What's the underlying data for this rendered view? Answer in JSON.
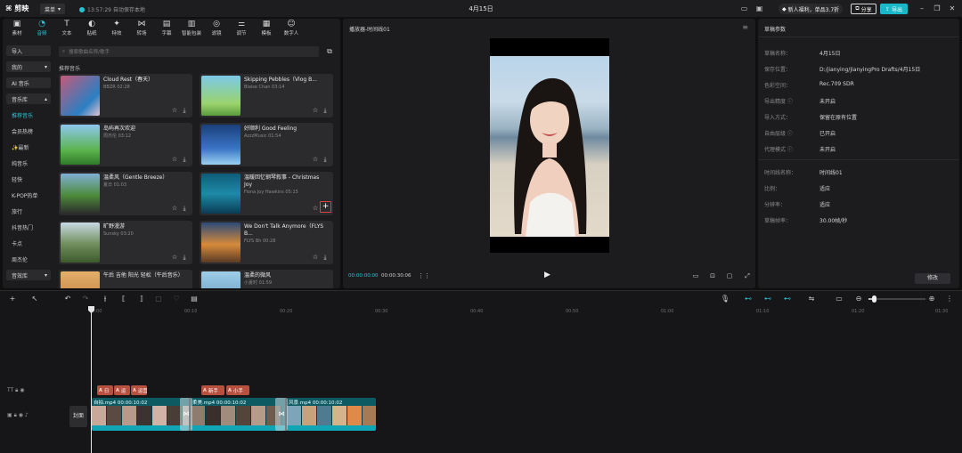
{
  "titlebar": {
    "app_name": "剪映",
    "menu_label": "菜单",
    "autosave": "13:57:29 自动保存本地",
    "doc_title": "4月15日",
    "newbie": "新人福利，单品3.7折",
    "share": "分享",
    "export": "导出"
  },
  "tools": [
    {
      "label": "素材",
      "icon": "media-icon"
    },
    {
      "label": "音频",
      "icon": "audio-icon"
    },
    {
      "label": "文本",
      "icon": "text-icon"
    },
    {
      "label": "贴纸",
      "icon": "sticker-icon"
    },
    {
      "label": "特效",
      "icon": "effects-icon"
    },
    {
      "label": "转场",
      "icon": "transition-icon"
    },
    {
      "label": "字幕",
      "icon": "subtitle-icon"
    },
    {
      "label": "智能包装",
      "icon": "smart-pack-icon"
    },
    {
      "label": "滤镜",
      "icon": "filter-icon"
    },
    {
      "label": "调节",
      "icon": "adjust-icon"
    },
    {
      "label": "模板",
      "icon": "template-icon"
    },
    {
      "label": "数字人",
      "icon": "digital-human-icon"
    }
  ],
  "categories": {
    "import": "导入",
    "mine": "我的",
    "ai_music": "AI 音乐",
    "music_lib": "音乐库",
    "subs": [
      "推荐音乐",
      "会员热榜",
      "✨最新",
      "纯音乐",
      "轻快",
      "K-POP热单",
      "旅行",
      "抖音热门",
      "卡点",
      "周杰伦"
    ],
    "sfx_lib": "音效库"
  },
  "search": {
    "placeholder": "搜索歌曲名称/歌手"
  },
  "section_title": "推荐音乐",
  "music": [
    {
      "title": "Cloud Rest（春天）",
      "artist": "BBZR 02:28"
    },
    {
      "title": "Skipping Pebbles（Vlog B...",
      "artist": "Blaise Chan 03:14"
    },
    {
      "title": "岛屿再次欢迎",
      "artist": "周杰伦 03:12"
    },
    {
      "title": "好顺利 Good Feeling",
      "artist": "AzzzMusic 01:54"
    },
    {
      "title": "温柔风（Gentle Breeze）",
      "artist": "夏日 01:03"
    },
    {
      "title": "温暖回忆钢琴叙事 - Christmas Joy",
      "artist": "Fiona Joy Hawkins 05:15"
    },
    {
      "title": "旷野漫游",
      "artist": "Sunsky 03:20"
    },
    {
      "title": "We Don't Talk Anymore（FLYS B...",
      "artist": "FLYS Bh 00:28"
    },
    {
      "title": "午后 吉他 阳光 轻松（午后音乐）",
      "artist": ""
    },
    {
      "title": "温柔的微风",
      "artist": "小夏时 01:59"
    }
  ],
  "player": {
    "title": "播放器-时间线01",
    "time_current": "00:00:00:00",
    "time_total": "00:00:30:06"
  },
  "draft": {
    "title": "草稿参数",
    "rows": [
      {
        "k": "草稿名称：",
        "v": "4月15日"
      },
      {
        "k": "保存位置：",
        "v": "D:/jianying/JianyingPro Drafts/4月15日"
      },
      {
        "k": "色彩空间：",
        "v": "Rec.709 SDR"
      },
      {
        "k": "导出精度 ⓘ",
        "v": "未开启"
      },
      {
        "k": "导入方式：",
        "v": "保留在原有位置"
      },
      {
        "k": "自由层级 ⓘ",
        "v": "已开启"
      },
      {
        "k": "代理模式 ⓘ",
        "v": "未开启"
      },
      {
        "k": "时间线名称：",
        "v": "时间线01"
      },
      {
        "k": "比例：",
        "v": "适应"
      },
      {
        "k": "分辨率：",
        "v": "适应"
      },
      {
        "k": "草稿帧率：",
        "v": "30.00帧/秒"
      }
    ],
    "modify": "修改"
  },
  "timeline": {
    "ticks": [
      "00:00",
      "00:10",
      "00:20",
      "00:30",
      "00:40",
      "00:50",
      "01:00",
      "01:10",
      "01:20",
      "01:30"
    ],
    "cover": "封面",
    "text_clips": [
      {
        "icon": "A",
        "label": "日"
      },
      {
        "icon": "A",
        "label": "运"
      },
      {
        "icon": "A",
        "label": "运营"
      },
      {
        "icon": "A",
        "label": "新手"
      },
      {
        "icon": "A",
        "label": "小手"
      }
    ],
    "video_clips": [
      {
        "label": "自拍.mp4  00:00:10:02"
      },
      {
        "label": "柔美.mp4  00:00:10:02"
      },
      {
        "label": "风景.mp4  00:00:10:02"
      }
    ]
  },
  "colors": {
    "accent": "#28c6d6",
    "highlight_box": "#e04040",
    "text_clip": "#b8503f",
    "video_clip": "#0e5a63"
  }
}
